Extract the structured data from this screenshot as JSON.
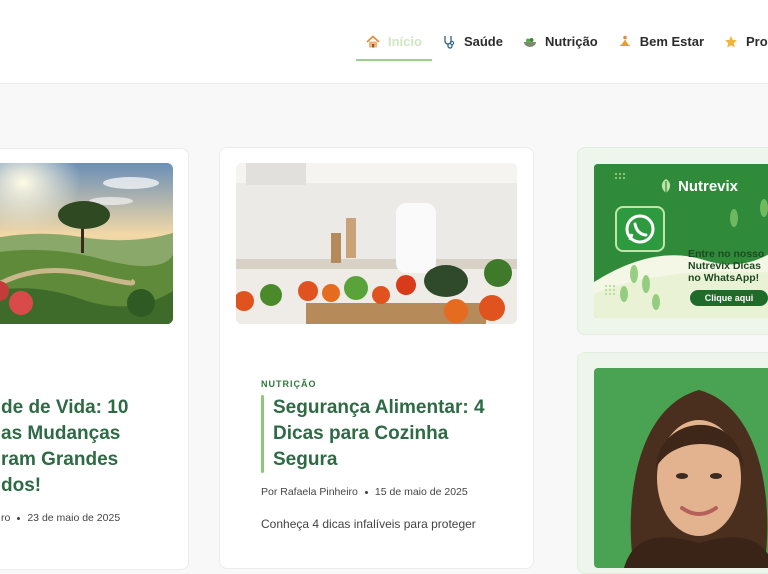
{
  "nav": {
    "items": [
      {
        "label": "Início",
        "icon": "home-icon"
      },
      {
        "label": "Saúde",
        "icon": "stethoscope-icon"
      },
      {
        "label": "Nutrição",
        "icon": "salad-icon"
      },
      {
        "label": "Bem Estar",
        "icon": "meditation-icon"
      },
      {
        "label": "Produto",
        "icon": "star-icon"
      }
    ],
    "active_color": "#cfe6c5"
  },
  "posts": [
    {
      "title_lines": [
        "de de Vida: 10",
        "as Mudanças",
        "ram Grandes",
        "dos!"
      ],
      "author_fragment": "ro",
      "date": "23 de maio de 2025"
    },
    {
      "category": "NUTRIÇÃO",
      "title_lines": [
        "Segurança Alimentar: 4",
        "Dicas para Cozinha",
        "Segura"
      ],
      "author": "Por Rafaela Pinheiro",
      "date": "15 de maio de 2025",
      "excerpt": "Conheça 4 dicas infalíveis para proteger"
    }
  ],
  "sidebar": {
    "promo": {
      "brand": "Nutrevix",
      "text_lines": [
        "Entre no nosso",
        "Nutrevix Dicas",
        "no WhatsApp!"
      ],
      "button": "Clique aqui"
    }
  },
  "colors": {
    "title": "#2e6b45",
    "accent": "#8bc97a",
    "promo_green": "#2f8a3a"
  }
}
